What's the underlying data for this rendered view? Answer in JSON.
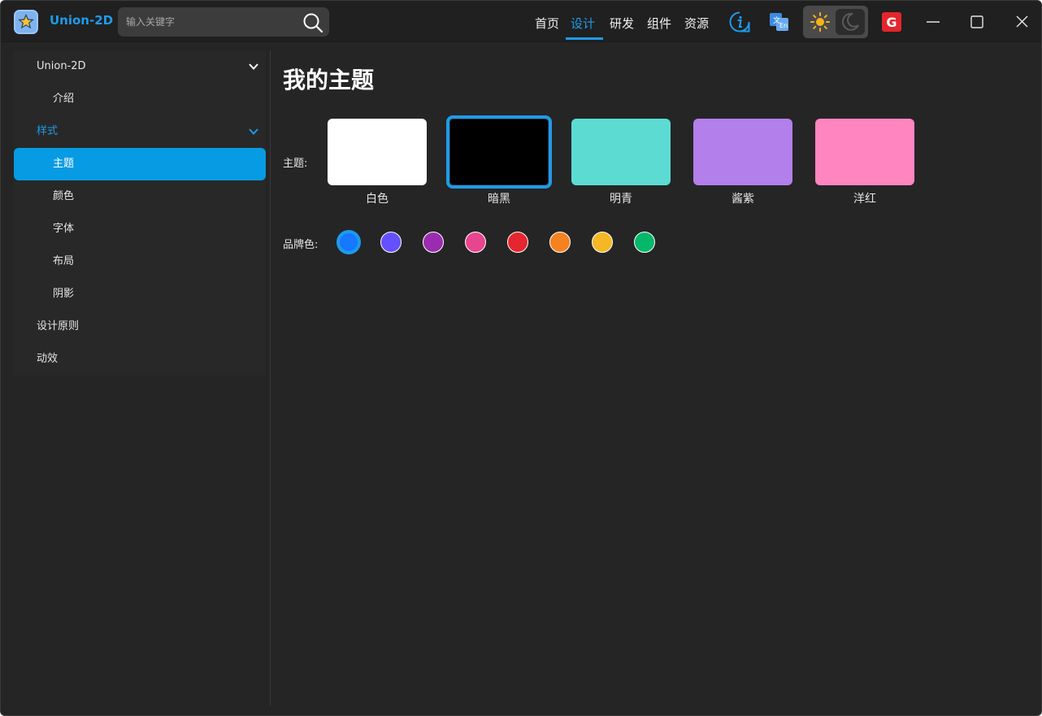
{
  "app": {
    "name": "Union-2D"
  },
  "search": {
    "placeholder": "输入关键字"
  },
  "nav": {
    "items": [
      {
        "label": "首页"
      },
      {
        "label": "设计",
        "active": true
      },
      {
        "label": "研发"
      },
      {
        "label": "组件"
      },
      {
        "label": "资源"
      }
    ]
  },
  "toolbar": {
    "icons": [
      "info-icon",
      "translate-icon",
      "sun-icon",
      "moon-icon",
      "g-logo-icon"
    ],
    "window_controls": [
      "minimize-icon",
      "maximize-icon",
      "close-icon"
    ],
    "g_letter": "G"
  },
  "sidebar": {
    "items": [
      {
        "label": "Union-2D",
        "expanded": true
      },
      {
        "label": "介绍"
      },
      {
        "label": "样式",
        "expanded": true,
        "accent": true
      },
      {
        "label": "主题",
        "active": true
      },
      {
        "label": "颜色"
      },
      {
        "label": "字体"
      },
      {
        "label": "布局"
      },
      {
        "label": "阴影"
      },
      {
        "label": "设计原则"
      },
      {
        "label": "动效"
      }
    ]
  },
  "main": {
    "title": "我的主题",
    "theme_label": "主题:",
    "brand_label": "品牌色:",
    "themes": [
      {
        "name": "白色",
        "color": "#ffffff"
      },
      {
        "name": "暗黑",
        "color": "#000000",
        "selected": true
      },
      {
        "name": "明青",
        "color": "#5cdbd3"
      },
      {
        "name": "酱紫",
        "color": "#b37feb"
      },
      {
        "name": "洋红",
        "color": "#ff85c0"
      }
    ],
    "brand_colors": [
      {
        "color": "#1677ff",
        "selected": true
      },
      {
        "color": "#6550ff"
      },
      {
        "color": "#9c2caf"
      },
      {
        "color": "#e8458f"
      },
      {
        "color": "#e5262f"
      },
      {
        "color": "#f58220"
      },
      {
        "color": "#f5b824"
      },
      {
        "color": "#04b86a"
      }
    ]
  },
  "colors": {
    "accent": "#1e9bea",
    "background": "#252525",
    "sidebar": "#282828"
  }
}
